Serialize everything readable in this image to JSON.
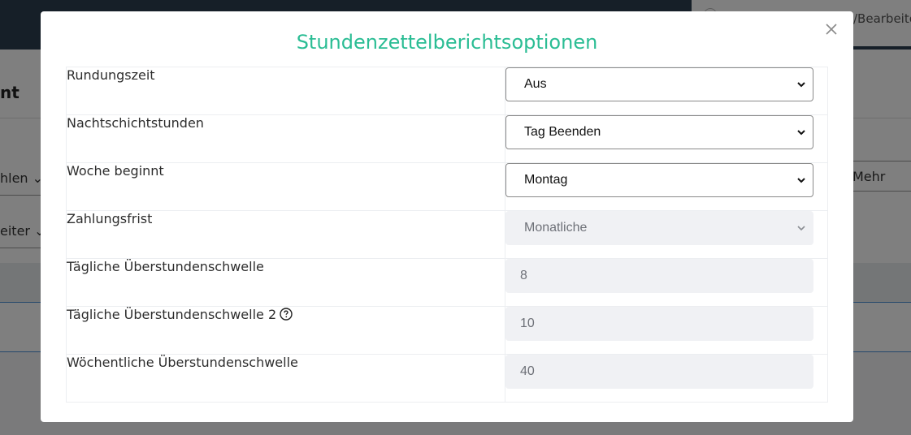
{
  "background": {
    "breadcrumb": "/Bearbeiten",
    "header_text": "nt",
    "filter_1": "hlen",
    "filter_2": "eiter",
    "more_button": "Mehr"
  },
  "modal": {
    "title": "Stundenzettelberichtsoptionen",
    "close_icon": "close-icon",
    "rows": [
      {
        "label": "Rundungszeit",
        "type": "select",
        "value": "Aus",
        "disabled": false
      },
      {
        "label": "Nachtschichtstunden",
        "type": "select",
        "value": "Tag Beenden",
        "disabled": false
      },
      {
        "label": "Woche beginnt",
        "type": "select",
        "value": "Montag",
        "disabled": false
      },
      {
        "label": "Zahlungsfrist",
        "type": "select",
        "value": "Monatliche",
        "disabled": true
      },
      {
        "label": "Tägliche Überstundenschwelle",
        "type": "number",
        "value": "8",
        "disabled": true
      },
      {
        "label": "Tägliche Überstundenschwelle 2",
        "type": "number",
        "value": "10",
        "disabled": true,
        "help_icon": "question-circle-icon"
      },
      {
        "label": "Wöchentliche Überstundenschwelle",
        "type": "number",
        "value": "40",
        "disabled": true
      }
    ]
  },
  "colors": {
    "title": "#2bbd94",
    "overlay": "rgba(0,0,0,0.5)",
    "disabled_field": "#f0f1f4"
  }
}
